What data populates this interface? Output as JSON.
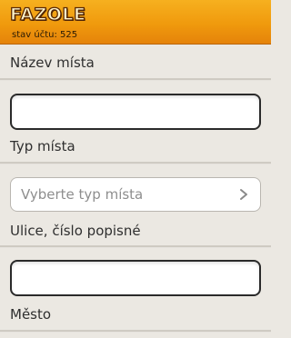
{
  "header": {
    "logo_text": "FAZOLE",
    "balance_text": "stav účtu: 525",
    "accent_color": "#f09a0d"
  },
  "form": {
    "place_name_label": "Název místa",
    "place_name_value": "",
    "place_type_label": "Typ místa",
    "place_type_placeholder": "Vyberte typ místa",
    "street_label": "Ulice, číslo popisné",
    "street_value": "",
    "city_label": "Město"
  },
  "icons": {
    "select_arrow": "chevron-right-icon"
  }
}
